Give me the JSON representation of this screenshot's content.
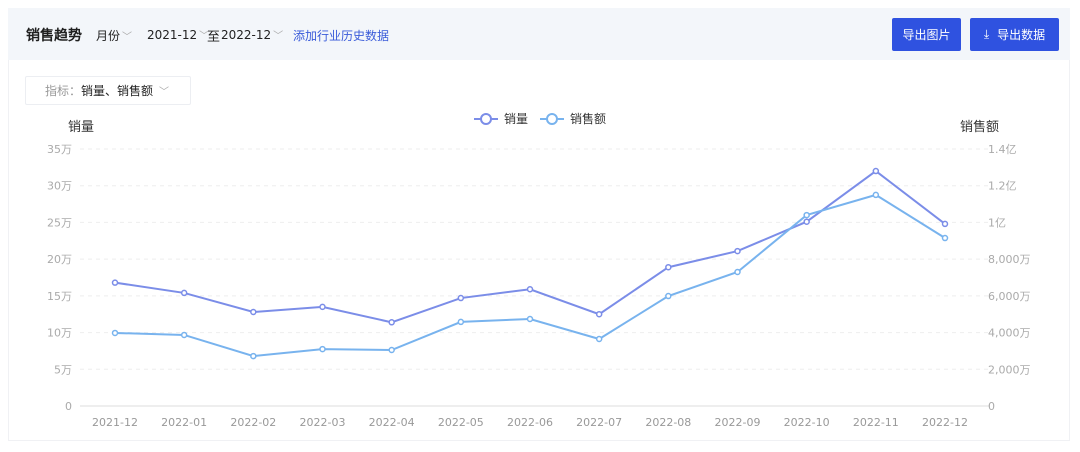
{
  "header": {
    "title": "销售趋势",
    "period": "月份",
    "start": "2021-12",
    "to": "至",
    "end": "2022-12",
    "add_link": "添加行业历史数据",
    "export_image": "导出图片",
    "export_data": "导出数据",
    "download_icon": "⤓"
  },
  "metric": {
    "label": "指标：",
    "value": "销量、销售额"
  },
  "colors": {
    "series1": "#7b8de8",
    "series2": "#78b3ee",
    "button": "#2f52e0"
  },
  "chart_data": {
    "type": "line",
    "categories": [
      "2021-12",
      "2022-01",
      "2022-02",
      "2022-03",
      "2022-04",
      "2022-05",
      "2022-06",
      "2022-07",
      "2022-08",
      "2022-09",
      "2022-10",
      "2022-11",
      "2022-12"
    ],
    "y_left": {
      "label": "销量",
      "unit": "万",
      "range": [
        0,
        35
      ],
      "ticks": [
        "0",
        "5万",
        "10万",
        "15万",
        "20万",
        "25万",
        "30万",
        "35万"
      ],
      "tick_values": [
        0,
        5,
        10,
        15,
        20,
        25,
        30,
        35
      ]
    },
    "y_right": {
      "label": "销售额",
      "unit": "万",
      "range": [
        0,
        14000
      ],
      "ticks": [
        "0",
        "2,000万",
        "4,000万",
        "6,000万",
        "8,000万",
        "1亿",
        "1.2亿",
        "1.4亿"
      ],
      "tick_values": [
        0,
        2000,
        4000,
        6000,
        8000,
        10000,
        12000,
        14000
      ]
    },
    "series": [
      {
        "name": "销量",
        "axis": "left",
        "values": [
          16.8,
          15.4,
          12.8,
          13.5,
          11.4,
          14.7,
          15.9,
          12.5,
          18.9,
          21.1,
          25.1,
          32.0,
          24.8
        ]
      },
      {
        "name": "销售额",
        "axis": "right",
        "values": [
          3980,
          3870,
          2720,
          3100,
          3050,
          4580,
          4740,
          3650,
          5990,
          7300,
          10400,
          11500,
          9150
        ]
      }
    ],
    "legend": "top-center",
    "grid": true
  }
}
